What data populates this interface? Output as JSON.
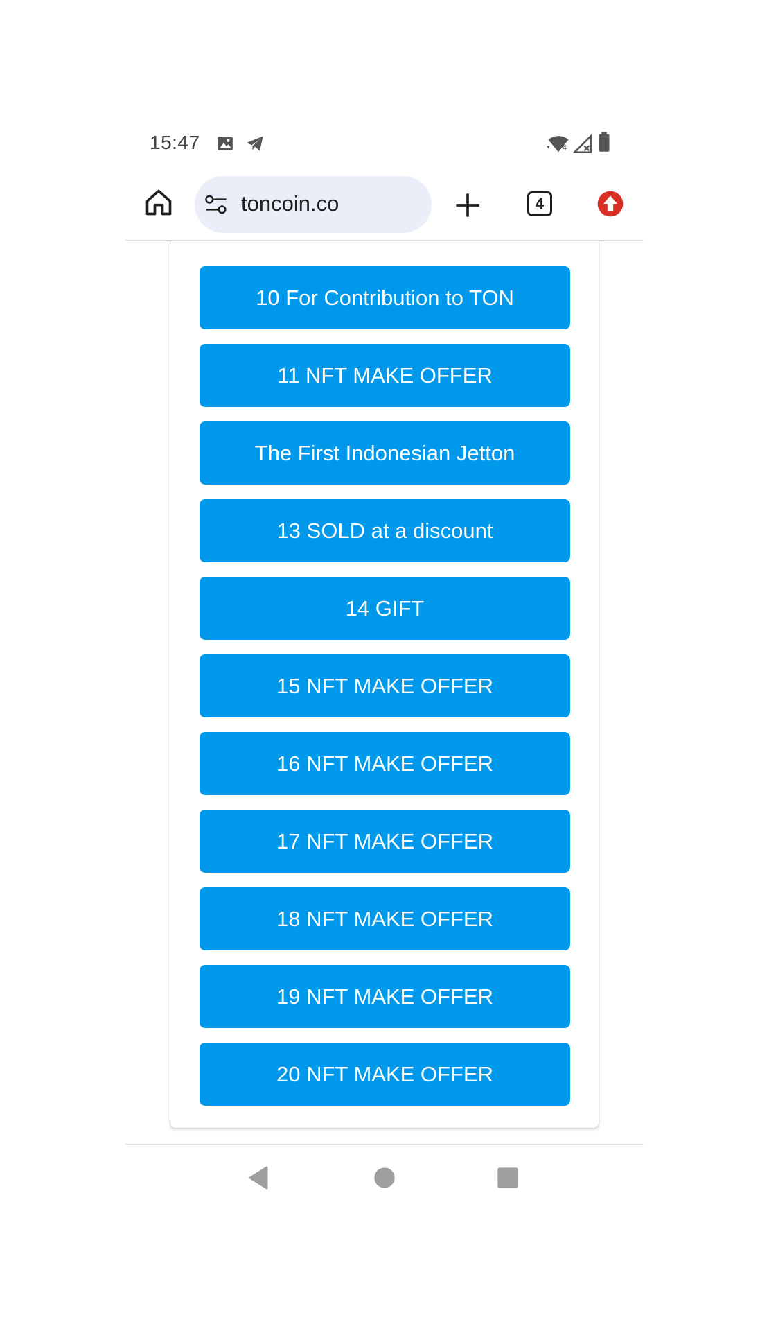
{
  "status_bar": {
    "time": "15:47",
    "icons": [
      "image-icon",
      "telegram-icon",
      "wifi-icon",
      "signal-icon",
      "battery-icon"
    ]
  },
  "browser": {
    "url": "toncoin.co",
    "tab_count": "4",
    "icons": [
      "home-icon",
      "site-settings-icon",
      "plus-icon",
      "tabs-icon",
      "update-icon"
    ]
  },
  "buttons": [
    {
      "label": "10 For Contribution to TON"
    },
    {
      "label": "11 NFT MAKE OFFER"
    },
    {
      "label": "The First Indonesian Jetton"
    },
    {
      "label": "13 SOLD at a discount"
    },
    {
      "label": "14 GIFT"
    },
    {
      "label": "15 NFT MAKE OFFER"
    },
    {
      "label": "16 NFT MAKE OFFER"
    },
    {
      "label": "17 NFT MAKE OFFER"
    },
    {
      "label": "18 NFT MAKE OFFER"
    },
    {
      "label": "19 NFT MAKE OFFER"
    },
    {
      "label": "20 NFT MAKE OFFER"
    }
  ],
  "colors": {
    "button_bg": "#0098ea",
    "button_text": "#ffffff",
    "url_bar_bg": "#eaeef9",
    "update_badge": "#d93025",
    "nav_icon": "#9e9e9e"
  },
  "nav_bar": {
    "icons": [
      "back-icon",
      "home-circle-icon",
      "recents-icon"
    ]
  }
}
